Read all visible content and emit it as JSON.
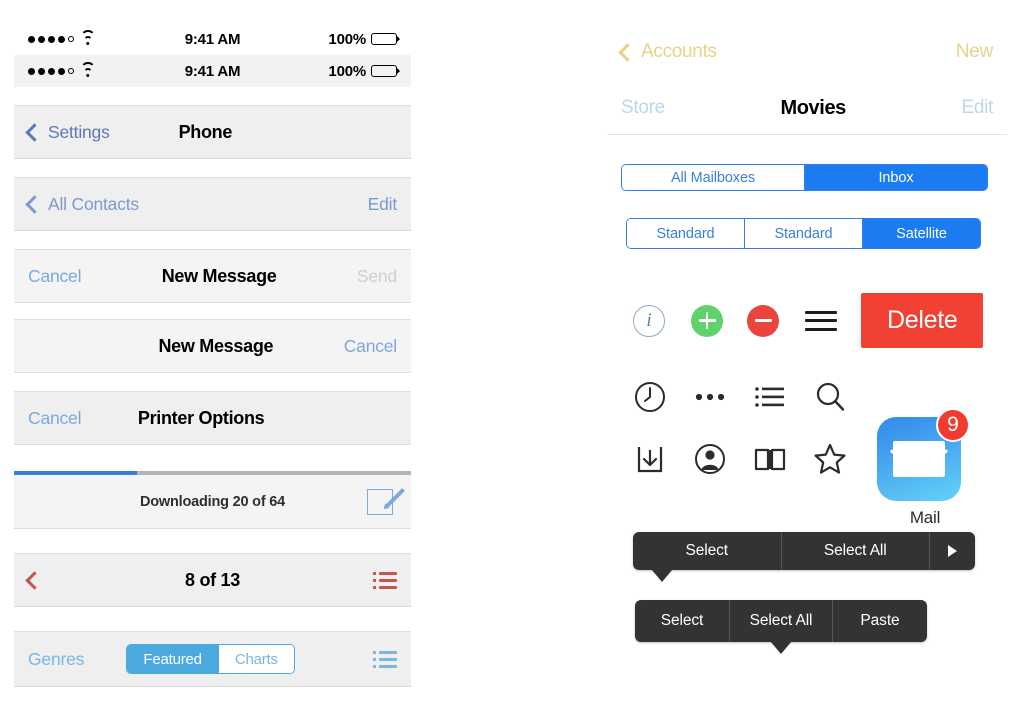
{
  "left": {
    "status_bars": [
      {
        "signal_filled": 4,
        "signal_empty": 1,
        "time": "9:41 AM",
        "battery_pct": "100%",
        "battery_color": "#3ddc53",
        "bg": "white"
      },
      {
        "signal_filled": 4,
        "signal_empty": 1,
        "time": "9:41 AM",
        "battery_pct": "100%",
        "battery_color": "#000000",
        "bg": "grey"
      }
    ],
    "nav_settings": {
      "back_label": "Settings",
      "title": "Phone",
      "right_label": ""
    },
    "nav_contacts": {
      "back_label": "All Contacts",
      "title": "",
      "right_label": "Edit"
    },
    "nav_new_message_1": {
      "left_label": "Cancel",
      "title": "New Message",
      "right_label": "Send"
    },
    "nav_new_message_2": {
      "left_label": "",
      "title": "New Message",
      "right_label": "Cancel"
    },
    "nav_printer": {
      "left_label": "Cancel",
      "title": "Printer Options",
      "right_label": ""
    },
    "progress_bar": {
      "percent": 31,
      "status_text": "Downloading 20 of 64",
      "icon": "compose-icon"
    },
    "nav_pager": {
      "back_icon": "chevron-left-icon",
      "title": "8 of 13",
      "right_icon": "list-icon"
    },
    "nav_genres": {
      "left_label": "Genres",
      "segments": [
        {
          "label": "Featured",
          "selected": true
        },
        {
          "label": "Charts",
          "selected": false
        }
      ],
      "right_icon": "list-icon"
    }
  },
  "right": {
    "nav_accounts": {
      "back_label": "Accounts",
      "right_label": "New",
      "color": "#e8d28a"
    },
    "nav_movies": {
      "left_label": "Store",
      "title": "Movies",
      "right_label": "Edit",
      "color": "#bcd7ea"
    },
    "segmented_mailboxes": [
      {
        "label": "All Mailboxes",
        "selected": false
      },
      {
        "label": "Inbox",
        "selected": true
      }
    ],
    "segmented_maps": [
      {
        "label": "Standard",
        "selected": false
      },
      {
        "label": "Standard",
        "selected": false
      },
      {
        "label": "Satellite",
        "selected": true
      }
    ],
    "action_row": {
      "info_icon": "info-circle-icon",
      "add_icon": "add-circle-icon",
      "remove_icon": "remove-circle-icon",
      "reorder_icon": "reorder-handle-icon",
      "delete_label": "Delete",
      "delete_color": "#f04134",
      "add_color": "#5fd36a",
      "remove_color": "#e8453c"
    },
    "icon_grid_row1": [
      "clock-icon",
      "ellipsis-icon",
      "bulleted-list-icon",
      "search-icon"
    ],
    "icon_grid_row2": [
      "download-tray-icon",
      "contact-circle-icon",
      "open-book-icon",
      "star-icon"
    ],
    "app_icon": {
      "name": "Mail",
      "badge_count": "9",
      "icon": "mail-envelope-icon"
    },
    "context_menu_1": {
      "items": [
        "Select",
        "Select All"
      ],
      "has_more_arrow": true,
      "tail_position": "bottom-left"
    },
    "context_menu_2": {
      "items": [
        "Select",
        "Select All",
        "Paste"
      ],
      "has_more_arrow": false,
      "tail_position": "bottom-center"
    }
  }
}
